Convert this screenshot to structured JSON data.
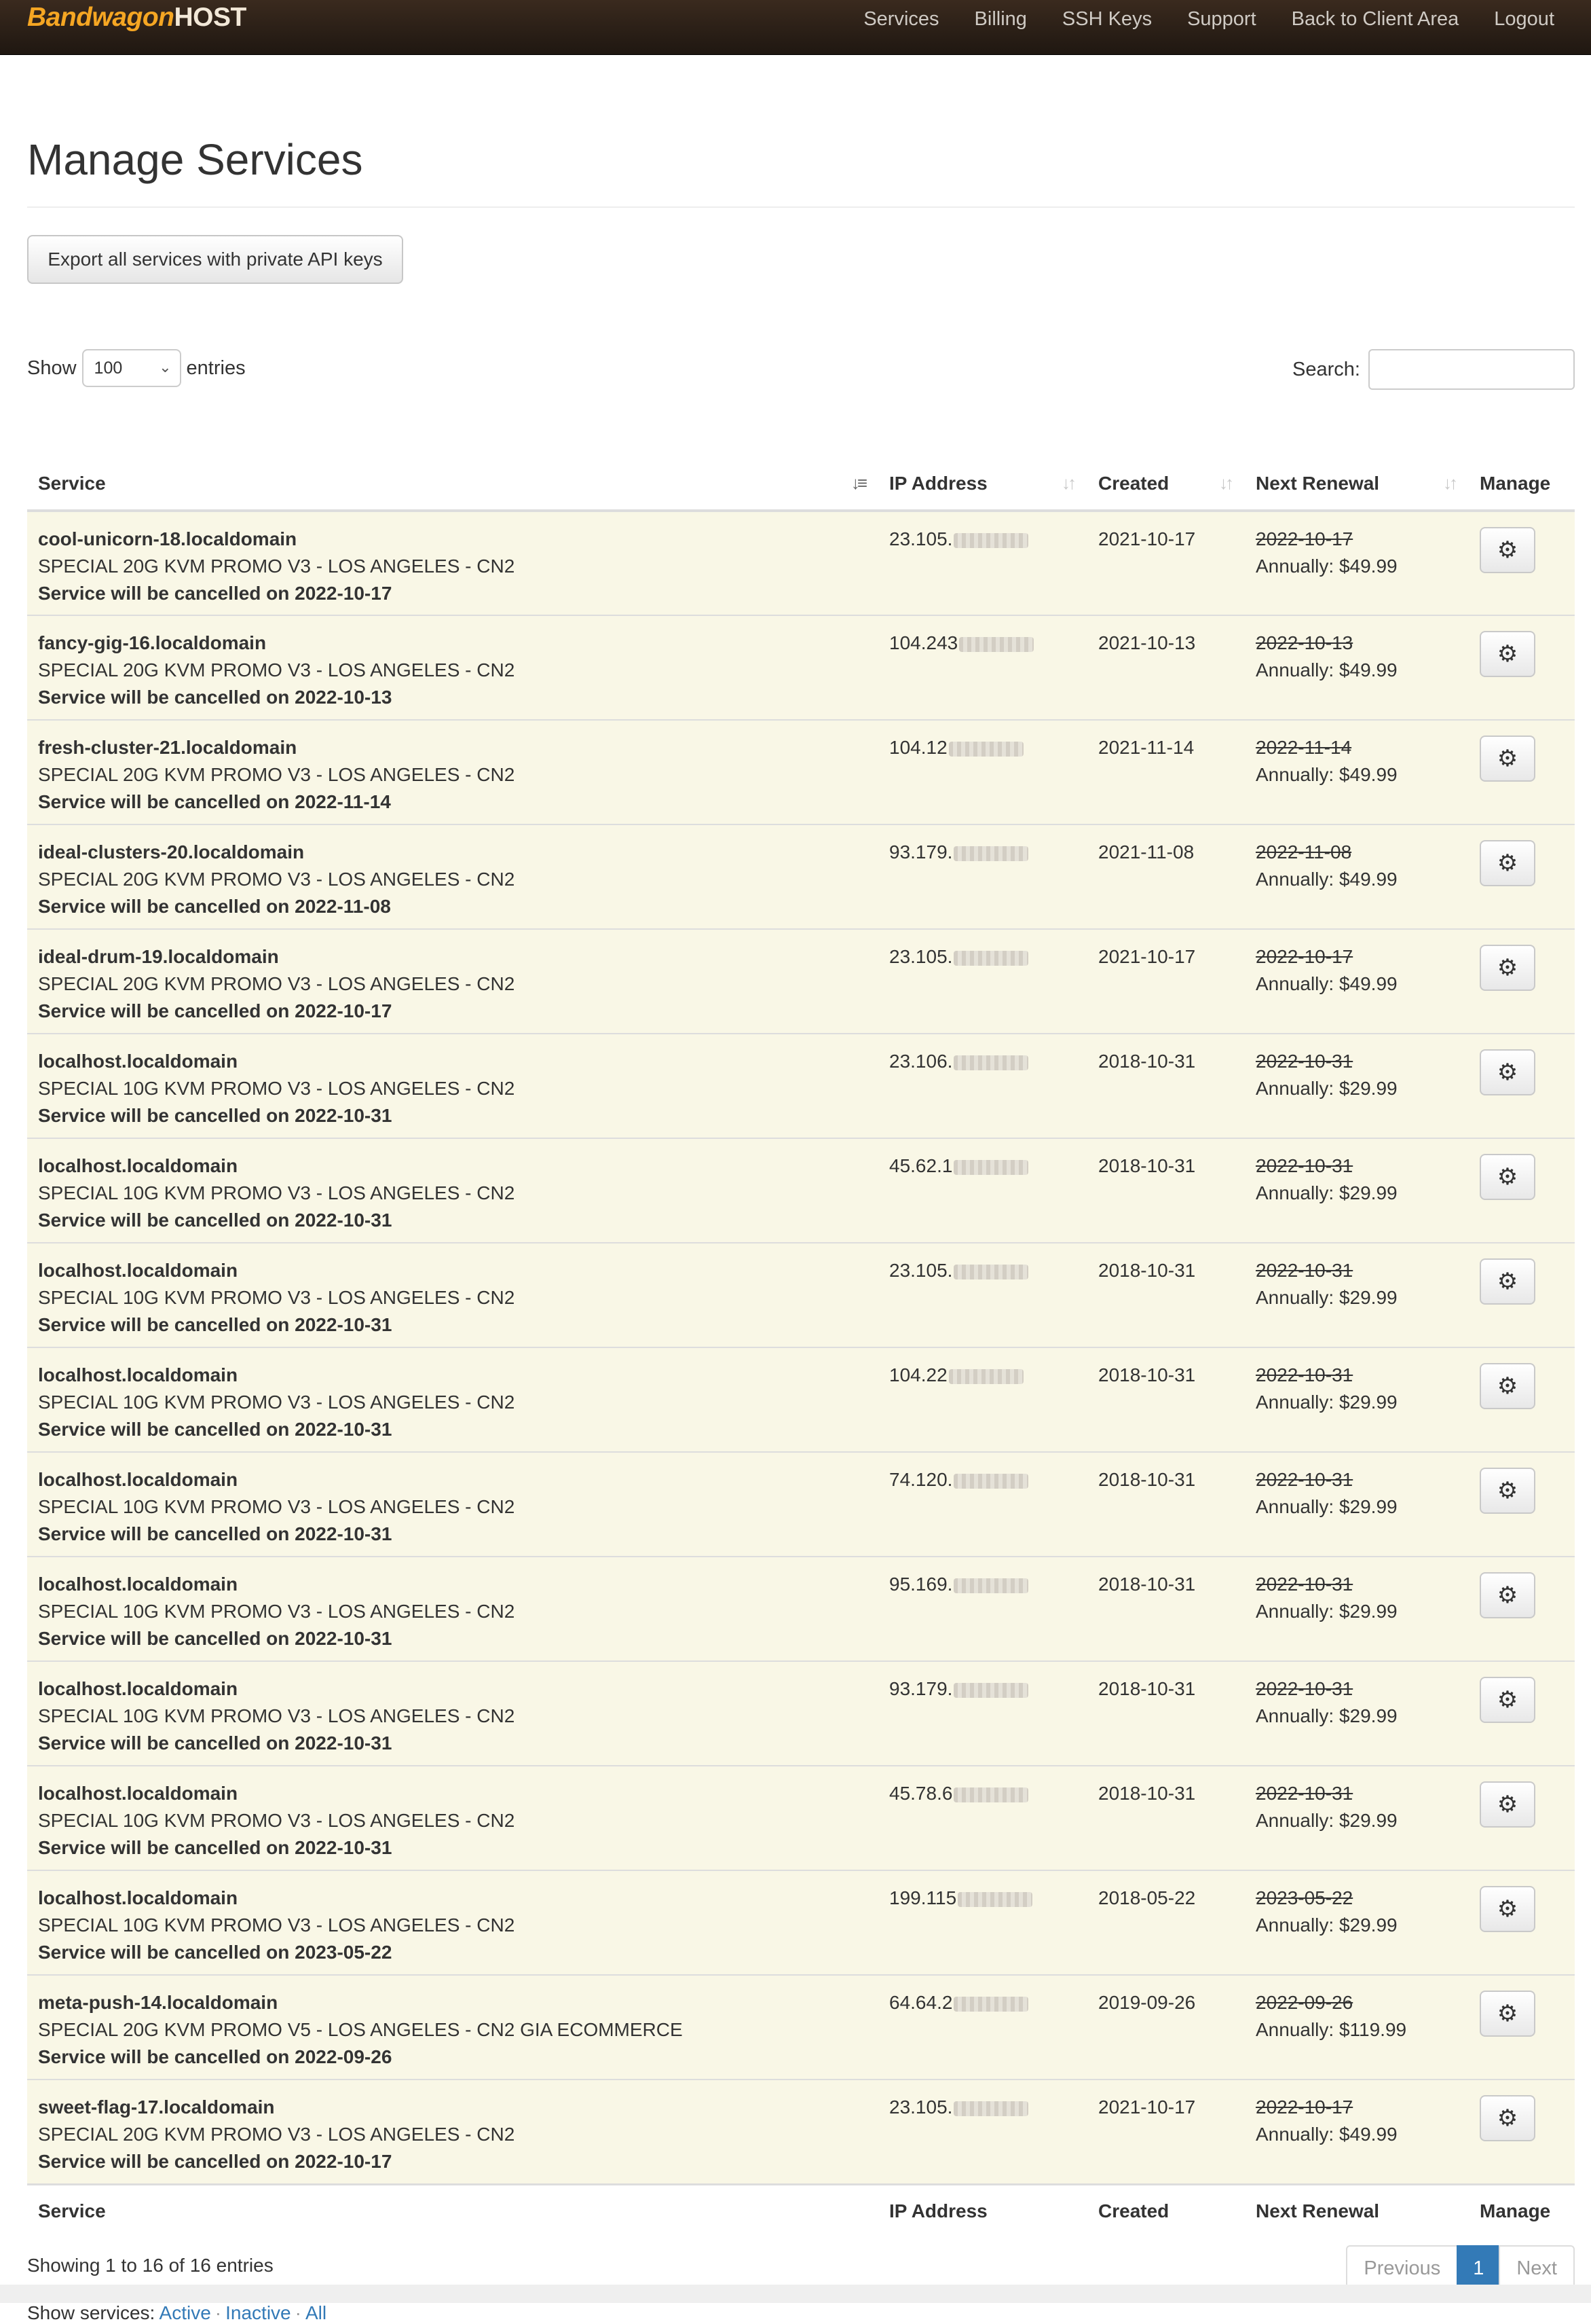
{
  "brand": {
    "name_a": "Bandwagon",
    "name_b": "HOST",
    "color": "#f5a623"
  },
  "nav": [
    "Services",
    "Billing",
    "SSH Keys",
    "Support",
    "Back to Client Area",
    "Logout"
  ],
  "page_title": "Manage Services",
  "export_button": "Export all services with private API keys",
  "length": {
    "show": "Show",
    "value": "100",
    "entries": "entries"
  },
  "search": {
    "label": "Search:",
    "value": ""
  },
  "columns": [
    "Service",
    "IP Address",
    "Created",
    "Next Renewal",
    "Manage"
  ],
  "rows": [
    {
      "name": "cool-unicorn-18.localdomain",
      "plan": "SPECIAL 20G KVM PROMO V3 - LOS ANGELES - CN2",
      "cancel": "Service will be cancelled on 2022-10-17",
      "ip": "23.105.",
      "created": "2021-10-17",
      "renewal": "2022-10-17",
      "price": "Annually: $49.99"
    },
    {
      "name": "fancy-gig-16.localdomain",
      "plan": "SPECIAL 20G KVM PROMO V3 - LOS ANGELES - CN2",
      "cancel": "Service will be cancelled on 2022-10-13",
      "ip": "104.243",
      "created": "2021-10-13",
      "renewal": "2022-10-13",
      "price": "Annually: $49.99"
    },
    {
      "name": "fresh-cluster-21.localdomain",
      "plan": "SPECIAL 20G KVM PROMO V3 - LOS ANGELES - CN2",
      "cancel": "Service will be cancelled on 2022-11-14",
      "ip": "104.12",
      "created": "2021-11-14",
      "renewal": "2022-11-14",
      "price": "Annually: $49.99"
    },
    {
      "name": "ideal-clusters-20.localdomain",
      "plan": "SPECIAL 20G KVM PROMO V3 - LOS ANGELES - CN2",
      "cancel": "Service will be cancelled on 2022-11-08",
      "ip": "93.179.",
      "created": "2021-11-08",
      "renewal": "2022-11-08",
      "price": "Annually: $49.99"
    },
    {
      "name": "ideal-drum-19.localdomain",
      "plan": "SPECIAL 20G KVM PROMO V3 - LOS ANGELES - CN2",
      "cancel": "Service will be cancelled on 2022-10-17",
      "ip": "23.105.",
      "created": "2021-10-17",
      "renewal": "2022-10-17",
      "price": "Annually: $49.99"
    },
    {
      "name": "localhost.localdomain",
      "plan": "SPECIAL 10G KVM PROMO V3 - LOS ANGELES - CN2",
      "cancel": "Service will be cancelled on 2022-10-31",
      "ip": "23.106.",
      "created": "2018-10-31",
      "renewal": "2022-10-31",
      "price": "Annually: $29.99"
    },
    {
      "name": "localhost.localdomain",
      "plan": "SPECIAL 10G KVM PROMO V3 - LOS ANGELES - CN2",
      "cancel": "Service will be cancelled on 2022-10-31",
      "ip": "45.62.1",
      "created": "2018-10-31",
      "renewal": "2022-10-31",
      "price": "Annually: $29.99"
    },
    {
      "name": "localhost.localdomain",
      "plan": "SPECIAL 10G KVM PROMO V3 - LOS ANGELES - CN2",
      "cancel": "Service will be cancelled on 2022-10-31",
      "ip": "23.105.",
      "created": "2018-10-31",
      "renewal": "2022-10-31",
      "price": "Annually: $29.99"
    },
    {
      "name": "localhost.localdomain",
      "plan": "SPECIAL 10G KVM PROMO V3 - LOS ANGELES - CN2",
      "cancel": "Service will be cancelled on 2022-10-31",
      "ip": "104.22",
      "created": "2018-10-31",
      "renewal": "2022-10-31",
      "price": "Annually: $29.99"
    },
    {
      "name": "localhost.localdomain",
      "plan": "SPECIAL 10G KVM PROMO V3 - LOS ANGELES - CN2",
      "cancel": "Service will be cancelled on 2022-10-31",
      "ip": "74.120.",
      "created": "2018-10-31",
      "renewal": "2022-10-31",
      "price": "Annually: $29.99"
    },
    {
      "name": "localhost.localdomain",
      "plan": "SPECIAL 10G KVM PROMO V3 - LOS ANGELES - CN2",
      "cancel": "Service will be cancelled on 2022-10-31",
      "ip": "95.169.",
      "created": "2018-10-31",
      "renewal": "2022-10-31",
      "price": "Annually: $29.99"
    },
    {
      "name": "localhost.localdomain",
      "plan": "SPECIAL 10G KVM PROMO V3 - LOS ANGELES - CN2",
      "cancel": "Service will be cancelled on 2022-10-31",
      "ip": "93.179.",
      "created": "2018-10-31",
      "renewal": "2022-10-31",
      "price": "Annually: $29.99"
    },
    {
      "name": "localhost.localdomain",
      "plan": "SPECIAL 10G KVM PROMO V3 - LOS ANGELES - CN2",
      "cancel": "Service will be cancelled on 2022-10-31",
      "ip": "45.78.6",
      "created": "2018-10-31",
      "renewal": "2022-10-31",
      "price": "Annually: $29.99"
    },
    {
      "name": "localhost.localdomain",
      "plan": "SPECIAL 10G KVM PROMO V3 - LOS ANGELES - CN2",
      "cancel": "Service will be cancelled on 2023-05-22",
      "ip": "199.115",
      "created": "2018-05-22",
      "renewal": "2023-05-22",
      "price": "Annually: $29.99"
    },
    {
      "name": "meta-push-14.localdomain",
      "plan": "SPECIAL 20G KVM PROMO V5 - LOS ANGELES - CN2 GIA ECOMMERCE",
      "cancel": "Service will be cancelled on 2022-09-26",
      "ip": "64.64.2",
      "created": "2019-09-26",
      "renewal": "2022-09-26",
      "price": "Annually: $119.99"
    },
    {
      "name": "sweet-flag-17.localdomain",
      "plan": "SPECIAL 20G KVM PROMO V3 - LOS ANGELES - CN2",
      "cancel": "Service will be cancelled on 2022-10-17",
      "ip": "23.105.",
      "created": "2021-10-17",
      "renewal": "2022-10-17",
      "price": "Annually: $49.99"
    }
  ],
  "manage_icon": "gear-icon",
  "info": "Showing 1 to 16 of 16 entries",
  "pagination": {
    "previous": "Previous",
    "current": "1",
    "next": "Next"
  },
  "filters": {
    "label": "Show services:",
    "active": "Active",
    "inactive": "Inactive",
    "all": "All"
  },
  "colors": {
    "row_bg": "#f9f7e6",
    "link": "#337ab7",
    "page_active": "#337ab7"
  }
}
